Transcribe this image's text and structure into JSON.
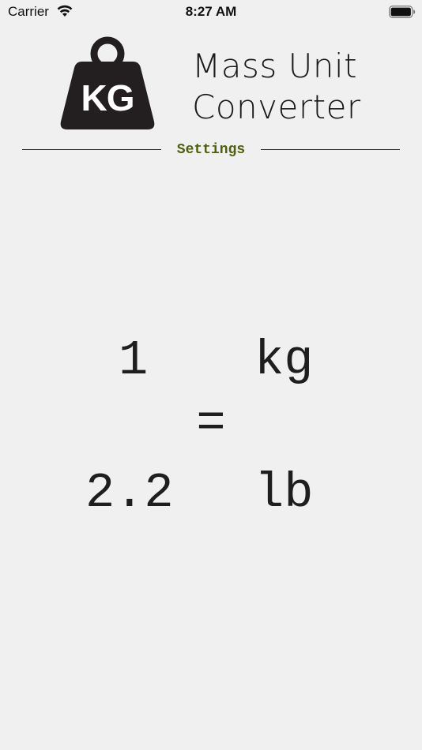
{
  "status_bar": {
    "carrier": "Carrier",
    "time": "8:27 AM",
    "wifi_icon": "wifi-icon",
    "battery_icon": "battery-icon"
  },
  "header": {
    "logo_icon": "kg-weight-icon",
    "logo_text": "KG",
    "title_line1": "Mass Unit",
    "title_line2": "Converter"
  },
  "settings": {
    "label": "Settings",
    "color": "#4e5e12"
  },
  "conversion": {
    "from_value": "1",
    "from_unit": "kg",
    "equals": "=",
    "to_value": "2.2",
    "to_unit": "lb"
  }
}
